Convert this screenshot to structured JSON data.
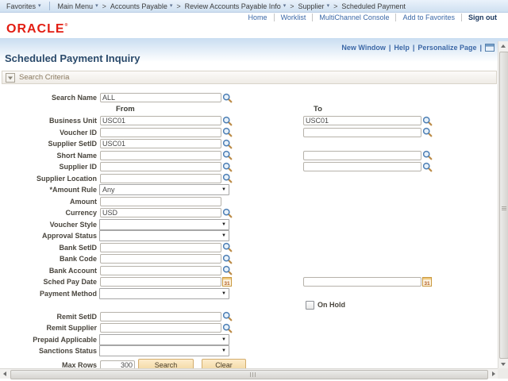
{
  "breadcrumb": {
    "favorites_label": "Favorites",
    "separator": ">",
    "items": [
      {
        "label": "Main Menu",
        "has_menu": true
      },
      {
        "label": "Accounts Payable",
        "has_menu": true
      },
      {
        "label": "Review Accounts Payable Info",
        "has_menu": true
      },
      {
        "label": "Supplier",
        "has_menu": true
      },
      {
        "label": "Scheduled Payment",
        "has_menu": false
      }
    ]
  },
  "header": {
    "logo": "ORACLE",
    "logo_mark": "®",
    "links": [
      "Home",
      "Worklist",
      "MultiChannel Console",
      "Add to Favorites"
    ],
    "sign_out": "Sign out"
  },
  "page": {
    "links": [
      "New Window",
      "Help",
      "Personalize Page"
    ],
    "link_separator": "|",
    "title": "Scheduled Payment Inquiry"
  },
  "section": {
    "title": "Search Criteria"
  },
  "form": {
    "from_label": "From",
    "to_label": "To",
    "rows": [
      {
        "id": "search-name",
        "label": "Search Name",
        "type": "lookup",
        "value": "ALL"
      },
      {
        "id": "from-to-header",
        "type": "columns-header"
      },
      {
        "id": "business-unit",
        "label": "Business Unit",
        "type": "lookup",
        "value": "USC01",
        "to": {
          "type": "lookup",
          "value": "USC01"
        }
      },
      {
        "id": "voucher-id",
        "label": "Voucher ID",
        "type": "lookup",
        "value": "",
        "to": {
          "type": "lookup",
          "value": ""
        }
      },
      {
        "id": "supplier-setid",
        "label": "Supplier SetID",
        "type": "lookup",
        "value": "USC01"
      },
      {
        "id": "short-name",
        "label": "Short Name",
        "type": "lookup",
        "value": "",
        "to": {
          "type": "lookup",
          "value": ""
        }
      },
      {
        "id": "supplier-id",
        "label": "Supplier ID",
        "type": "lookup",
        "value": "",
        "to": {
          "type": "lookup",
          "value": ""
        }
      },
      {
        "id": "supplier-location",
        "label": "Supplier Location",
        "type": "lookup",
        "value": ""
      },
      {
        "id": "amount-rule",
        "label": "*Amount Rule",
        "type": "select",
        "value": "Any"
      },
      {
        "id": "amount",
        "label": "Amount",
        "type": "text",
        "value": ""
      },
      {
        "id": "currency",
        "label": "Currency",
        "type": "lookup",
        "value": "USD"
      },
      {
        "id": "voucher-style",
        "label": "Voucher Style",
        "type": "select",
        "value": ""
      },
      {
        "id": "approval-status",
        "label": "Approval Status",
        "type": "select",
        "value": ""
      },
      {
        "id": "bank-setid",
        "label": "Bank SetID",
        "type": "lookup",
        "value": ""
      },
      {
        "id": "bank-code",
        "label": "Bank Code",
        "type": "lookup",
        "value": ""
      },
      {
        "id": "bank-account",
        "label": "Bank Account",
        "type": "lookup",
        "value": ""
      },
      {
        "id": "sched-pay-date",
        "label": "Sched Pay Date",
        "type": "date",
        "value": "",
        "to": {
          "type": "date",
          "value": ""
        }
      },
      {
        "id": "payment-method",
        "label": "Payment Method",
        "type": "select",
        "value": ""
      },
      {
        "id": "on-hold",
        "type": "checkbox-to",
        "checkbox_label": "On Hold",
        "checked": false
      },
      {
        "id": "remit-setid",
        "label": "Remit SetID",
        "type": "lookup",
        "value": ""
      },
      {
        "id": "remit-supplier",
        "label": "Remit Supplier",
        "type": "lookup",
        "value": ""
      },
      {
        "id": "prepaid-applicable",
        "label": "Prepaid Applicable",
        "type": "select",
        "value": ""
      },
      {
        "id": "sanctions-status",
        "label": "Sanctions Status",
        "type": "select",
        "value": ""
      }
    ],
    "actions": {
      "max_rows_label": "Max Rows",
      "max_rows_value": "300",
      "search_label": "Search",
      "clear_label": "Clear"
    }
  },
  "colors": {
    "oracle_red": "#e21d12",
    "link_blue": "#3a67a6",
    "title_blue": "#2a4a6b",
    "crumb_bg_top": "#eaf2fb",
    "crumb_bg_bottom": "#cfe0f1",
    "band_blue": "#c9ddf1",
    "section_title": "#8a795f",
    "button_face_top": "#fdeccb",
    "button_face_bottom": "#f2d8a2",
    "button_border": "#d3ad6d"
  }
}
